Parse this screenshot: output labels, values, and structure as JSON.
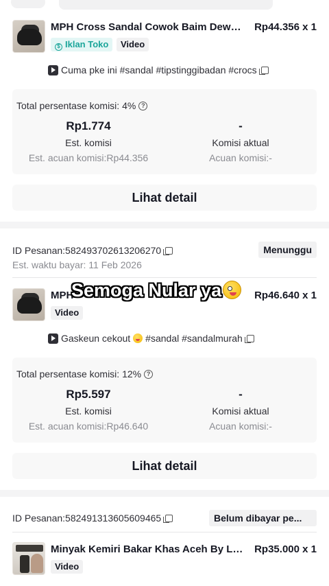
{
  "orders": [
    {
      "product": {
        "title": "MPH Cross Sandal Cowok Baim Dewas...",
        "price": "Rp44.356 x 1",
        "thumbnail_icon": "sandal-product-image"
      },
      "tags": {
        "ad": "Iklan Toko",
        "video": "Video"
      },
      "caption": {
        "text": "Cuma pke ini #sandal #tipstinggibadan #crocs"
      },
      "commission": {
        "title": "Total persentase komisi: 4%",
        "est_value": "Rp1.774",
        "est_label": "Est. komisi",
        "est_ref": "Est. acuan komisi:Rp44.356",
        "actual_value": "-",
        "actual_label": "Komisi aktual",
        "actual_ref": "Acuan komisi:-"
      },
      "detail_button": "Lihat detail"
    },
    {
      "order_id": "ID Pesanan:582493702613206270",
      "pay_time": "Est. waktu bayar: 11 Feb 2026",
      "status": "Menunggu",
      "product": {
        "title": "MPH",
        "title_tail": "s",
        "price": "Rp46.640 x 1",
        "thumbnail_icon": "sandal-product-image"
      },
      "tags": {
        "video": "Video"
      },
      "caption": {
        "text_before_emoji": "Gaskeun cekout",
        "text_after_emoji": " #sandal #sandalmurah"
      },
      "commission": {
        "title": "Total persentase komisi: 12%",
        "est_value": "Rp5.597",
        "est_label": "Est. komisi",
        "est_ref": "Est. acuan komisi:Rp46.640",
        "actual_value": "-",
        "actual_label": "Komisi aktual",
        "actual_ref": "Acuan komisi:-"
      },
      "detail_button": "Lihat detail"
    },
    {
      "order_id": "ID Pesanan:582491313605609465",
      "status": "Belum dibayar pe...",
      "product": {
        "title": "Minyak Kemiri Bakar Khas Aceh By Lea...",
        "price": "Rp35.000 x 1",
        "thumbnail_icon": "hair-oil-product-image"
      },
      "tags": {
        "video": "Video"
      }
    }
  ],
  "overlay_text": "Semoga Nular ya",
  "overlay_emoji": "zany-face-emoji",
  "colors": {
    "ad_tag_text": "#1aa59a",
    "ad_tag_bg": "#e3f6f5",
    "muted_text": "#8a8b91",
    "panel_bg": "#f8f8f8"
  }
}
